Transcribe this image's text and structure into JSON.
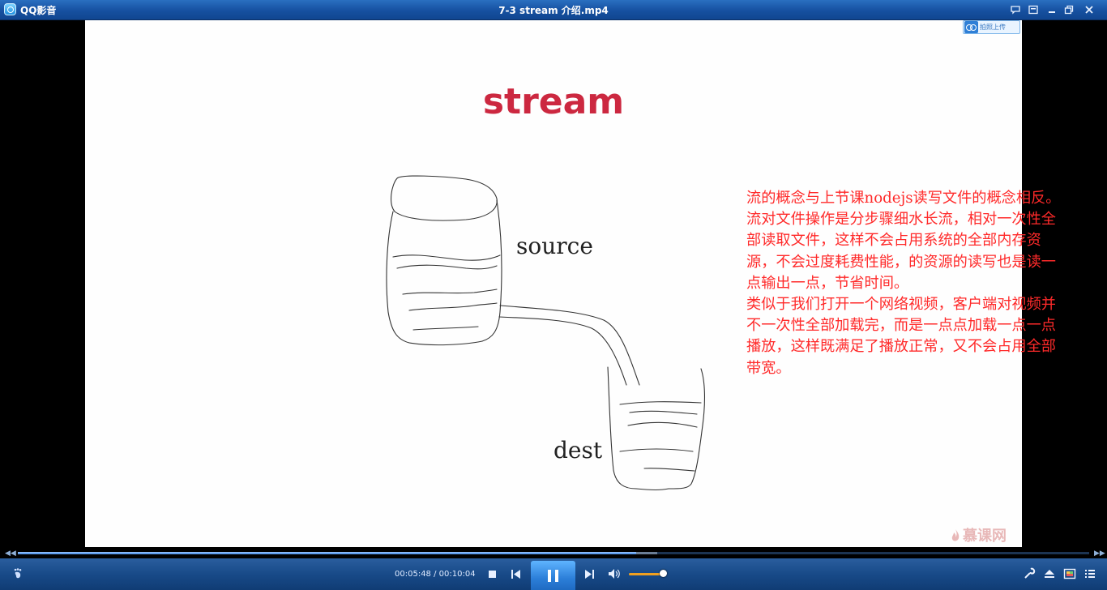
{
  "app": {
    "name": "QQ影音",
    "window_title": "7-3 stream 介绍.mp4"
  },
  "slide": {
    "title": "stream",
    "label_source": "source",
    "label_dest": "dest",
    "upload_badge": "拍照上传",
    "watermark": "慕课网"
  },
  "subtitle_lines": [
    "流的概念与上节课nodejs读写文件的概念相反。",
    "流对文件操作是分步骤细水长流，相对一次性全",
    "部读取文件，这样不会占用系统的全部内存资",
    "源，不会过度耗费性能，的资源的读写也是读一",
    "点输出一点，节省时间。",
    "类似于我们打开一个网络视频，客户端对视频并",
    "不一次性全部加载完，而是一点点加载一点一点",
    "播放，这样既满足了播放正常，又不会占用全部",
    "带宽。"
  ],
  "playback": {
    "elapsed": "00:05:48",
    "duration": "00:10:04",
    "time_separator": " / ",
    "progress_fraction": 0.577,
    "buffered_fraction": 0.02,
    "volume_fraction": 0.9,
    "state": "playing"
  },
  "colors": {
    "slide_title": "#cc2840",
    "subtitle": "#ff2a2a",
    "progress": "#3e86e0",
    "volume": "#f0a020"
  },
  "icons": {
    "titlebar": [
      "chat-bubble-icon",
      "mini-mode-icon",
      "minimize-icon",
      "restore-icon",
      "close-icon"
    ],
    "controls": [
      "footprint-icon",
      "stop-icon",
      "previous-icon",
      "pause-icon",
      "next-icon",
      "volume-icon",
      "settings-icon",
      "eject-icon",
      "screen-icon",
      "playlist-icon"
    ]
  }
}
